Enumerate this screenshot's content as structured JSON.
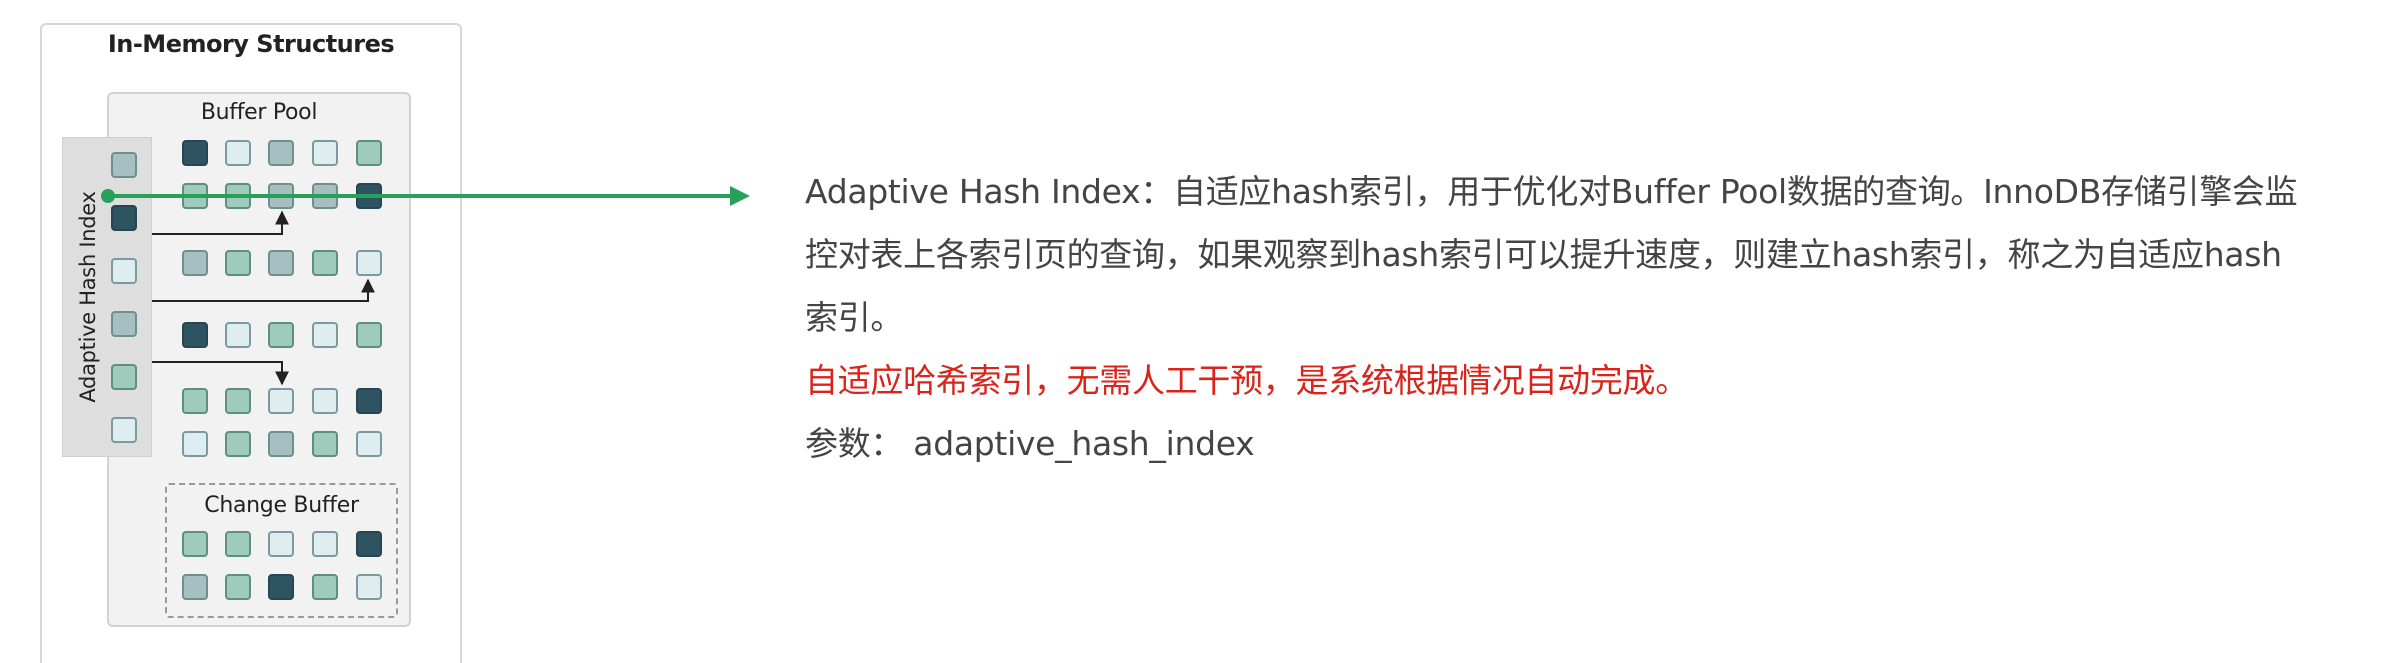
{
  "diagram": {
    "title": "In-Memory Structures",
    "buffer_pool_label": "Buffer Pool",
    "ahi_label": "Adaptive Hash Index",
    "change_buffer_label": "Change Buffer",
    "colors": {
      "dark": "#2f5461",
      "mid": "#a6bfc1",
      "teal": "#9fcbbd",
      "light": "#deedf0",
      "arrow": "#27a05a"
    },
    "ahi_cells": [
      "mid",
      "dark",
      "light",
      "mid",
      "teal",
      "light"
    ],
    "buffer_pool_rows": [
      [
        "dark",
        "light",
        "mid",
        "light",
        "teal"
      ],
      [
        "teal",
        "teal",
        "mid",
        "mid",
        "dark"
      ],
      [
        "mid",
        "teal",
        "mid",
        "teal",
        "light"
      ],
      [
        "dark",
        "light",
        "teal",
        "light",
        "teal"
      ],
      [
        "teal",
        "teal",
        "light",
        "light",
        "dark"
      ],
      [
        "light",
        "teal",
        "mid",
        "teal",
        "light"
      ]
    ],
    "change_buffer_rows": [
      [
        "teal",
        "teal",
        "light",
        "light",
        "dark"
      ],
      [
        "mid",
        "teal",
        "dark",
        "teal",
        "light"
      ]
    ]
  },
  "text": {
    "line1": "Adaptive Hash Index：自适应hash索引，用于优化对Buffer Pool数据的查询。InnoDB存储引擎会监",
    "line2": "控对表上各索引页的查询，如果观察到hash索引可以提升速度，则建立hash索引，称之为自适应hash",
    "line3": "索引。",
    "highlight": "自适应哈希索引，无需人工干预，是系统根据情况自动完成。",
    "param": "参数：  adaptive_hash_index"
  }
}
